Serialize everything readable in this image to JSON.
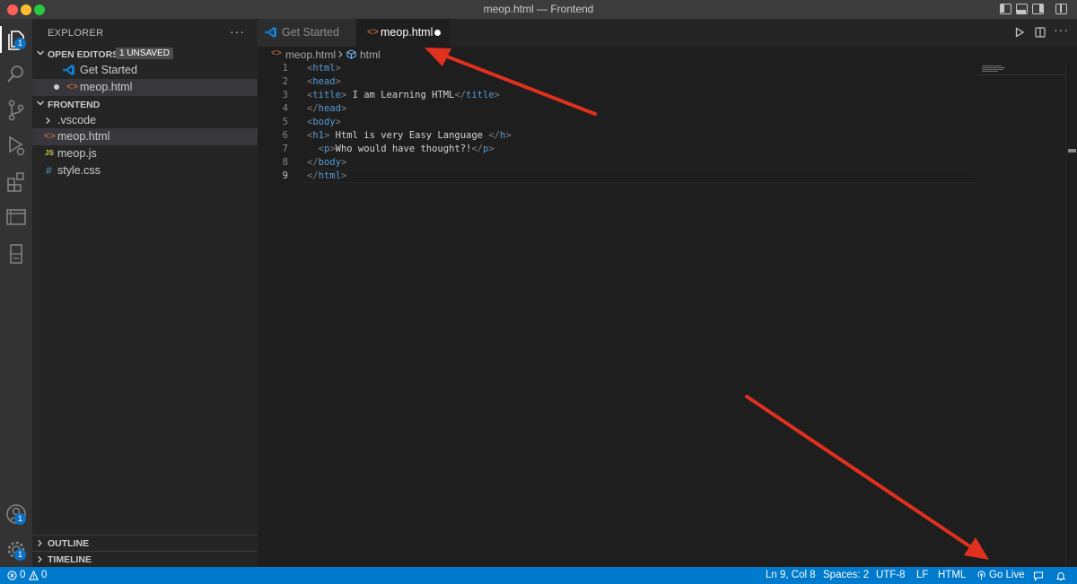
{
  "window": {
    "title": "meop.html — Frontend"
  },
  "activity_bar": {
    "explorer_badge": "1",
    "accounts_badge": "1",
    "manage_badge": "1"
  },
  "sidebar": {
    "header": "EXPLORER",
    "more": "···",
    "open_editors": {
      "title": "OPEN EDITORS",
      "badge": "1 UNSAVED",
      "items": [
        {
          "label": "Get Started",
          "icon": "vscode-logo-icon"
        },
        {
          "label": "meop.html",
          "icon": "html-file-icon",
          "dirty": true
        }
      ]
    },
    "folder": {
      "title": "FRONTEND",
      "items": [
        {
          "label": ".vscode",
          "icon": "folder-chevron-icon"
        },
        {
          "label": "meop.html",
          "icon": "html-file-icon"
        },
        {
          "label": "meop.js",
          "icon": "js-file-icon",
          "icon_text": "JS"
        },
        {
          "label": "style.css",
          "icon": "css-file-icon",
          "icon_text": "#"
        }
      ]
    },
    "outline": "OUTLINE",
    "timeline": "TIMELINE"
  },
  "tabs": [
    {
      "label": "Get Started",
      "active": false
    },
    {
      "label": "meop.html",
      "active": true,
      "dirty": true
    }
  ],
  "breadcrumb": {
    "file": "meop.html",
    "symbol": "html"
  },
  "editor": {
    "current_line": 9,
    "lines": [
      {
        "n": "1",
        "text": "<html>"
      },
      {
        "n": "2",
        "text": "<head>"
      },
      {
        "n": "3",
        "text": "<title> I am Learning HTML</title>"
      },
      {
        "n": "4",
        "text": "</head>"
      },
      {
        "n": "5",
        "text": "<body>"
      },
      {
        "n": "6",
        "text": "<h1> Html is very Easy Language </h>"
      },
      {
        "n": "7",
        "text": "  <p>Who would have thought?!</p>"
      },
      {
        "n": "8",
        "text": "</body>"
      },
      {
        "n": "9",
        "text": "</html>"
      }
    ]
  },
  "status_bar": {
    "errors": "0",
    "warnings": "0",
    "position": "Ln 9, Col 8",
    "spaces": "Spaces: 2",
    "encoding": "UTF-8",
    "eol": "LF",
    "language": "HTML",
    "go_live": "Go Live"
  },
  "colors": {
    "status_bar": "#007acc",
    "annotation_arrow": "#e0301e",
    "html_icon": "#e37933",
    "js_icon": "#cbcb41",
    "css_icon": "#519aba",
    "vscode_logo": "#0e80d4"
  }
}
